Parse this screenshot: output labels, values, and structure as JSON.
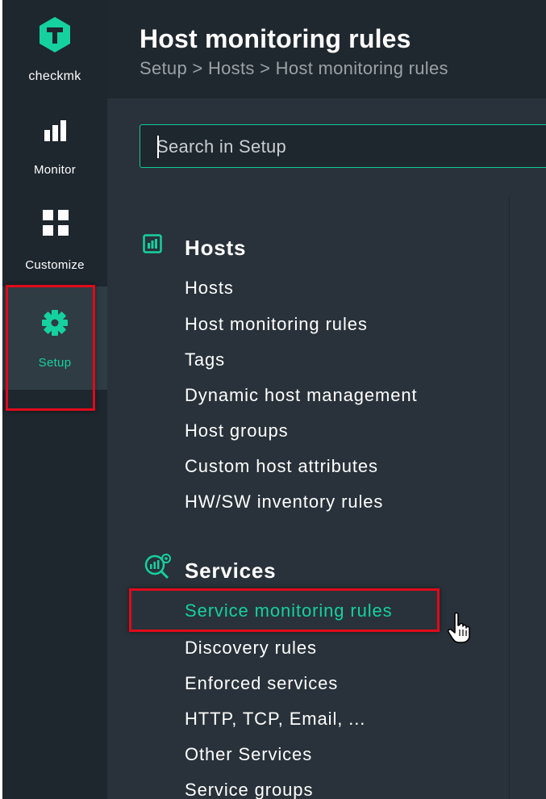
{
  "sidebar": {
    "logo_label": "checkmk",
    "items": [
      {
        "label": "Monitor",
        "icon": "bar-chart-icon"
      },
      {
        "label": "Customize",
        "icon": "grid-icon"
      },
      {
        "label": "Setup",
        "icon": "gear-icon"
      }
    ]
  },
  "header": {
    "title": "Host monitoring rules",
    "breadcrumb": "Setup > Hosts > Host monitoring rules"
  },
  "search": {
    "placeholder": "Search in Setup",
    "value": ""
  },
  "sections": [
    {
      "title": "Hosts",
      "icon": "hosts-chart-icon",
      "links": [
        "Hosts",
        "Host monitoring rules",
        "Tags",
        "Dynamic host management",
        "Host groups",
        "Custom host attributes",
        "HW/SW inventory rules"
      ]
    },
    {
      "title": "Services",
      "icon": "services-search-icon",
      "links": [
        "Service monitoring rules",
        "Discovery rules",
        "Enforced services",
        "HTTP, TCP, Email, ...",
        "Other Services",
        "Service groups"
      ]
    }
  ],
  "colors": {
    "accent": "#15d1a0",
    "sidebar_bg": "#1e262e",
    "content_bg": "#29323a",
    "highlight_red": "#e00a1b"
  }
}
